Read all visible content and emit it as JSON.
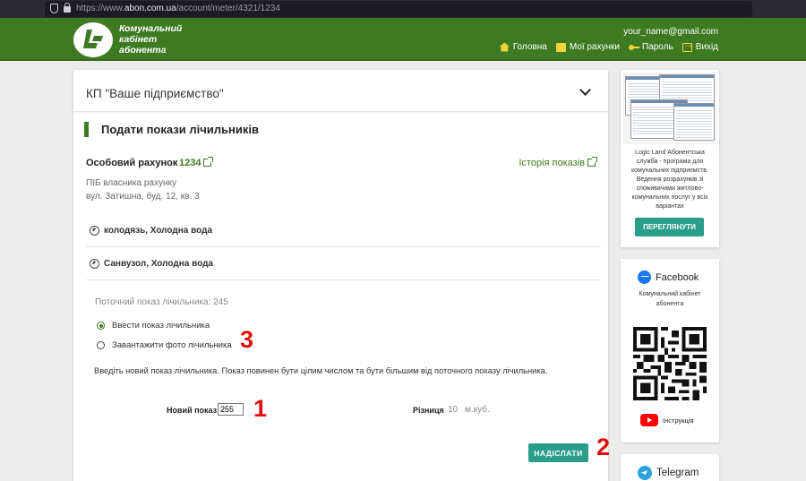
{
  "browser": {
    "url_prefix": "https://www.",
    "url_host": "abon.com.ua",
    "url_path": "/account/meter/4321/1234"
  },
  "header": {
    "logo_line1": "Комунальний",
    "logo_line2": "кабінет",
    "logo_line3": "абонента",
    "user_email": "your_name@gmail.com",
    "nav": {
      "home": "Головна",
      "accounts": "Мої рахунки",
      "password": "Пароль",
      "logout": "Вихід"
    },
    "colors": {
      "brand_green": "#3e7a21",
      "icon_yellow": "#f2d43a"
    }
  },
  "main": {
    "org_title": "КП \"Ваше підприємство\"",
    "section_title": "Подати покази лічильників",
    "account_label": "Особовий рахунок",
    "account_number": "1234",
    "history_link": "Історія показів",
    "owner": "ПІБ власника рахунку",
    "address": "вул. Затишна, буд. 12, кв. 3",
    "meters": [
      {
        "label": "колодязь, Холодна вода"
      },
      {
        "label": "Санвузол, Холодна вода"
      }
    ],
    "current_reading": "Поточний показ лічильника: 245",
    "options": {
      "enter": "Ввести показ лічильника",
      "upload": "Завантажити фото лічильника",
      "selected": "enter"
    },
    "hint": "Введіть новий показ лічильника. Показ повинен бути цілим числом та бути більшим від поточного показу лічильника.",
    "new_reading_label": "Новий показ",
    "new_reading_value": "255",
    "difference_label": "Різниця",
    "difference_value": "10",
    "difference_unit": "м.куб.",
    "submit_label": "НАДІСЛАТИ",
    "colors": {
      "button_teal": "#2b9e8a"
    }
  },
  "annotations": {
    "a1": "1",
    "a2": "2",
    "a3": "3",
    "color": "#e01010"
  },
  "sidebar": {
    "promo_text": "Logic Land Абонентська служба - програма для комунальних підприємств. Ведення розрахунків зі споживачами житлово-комунальних послуг у всіх варіантах",
    "view_button": "ПЕРЕГЛЯНУТИ",
    "facebook_title": "Facebook",
    "facebook_sub": "Комунальний кабінет абонента",
    "youtube_label": "Інструкція",
    "telegram_title": "Telegram"
  }
}
